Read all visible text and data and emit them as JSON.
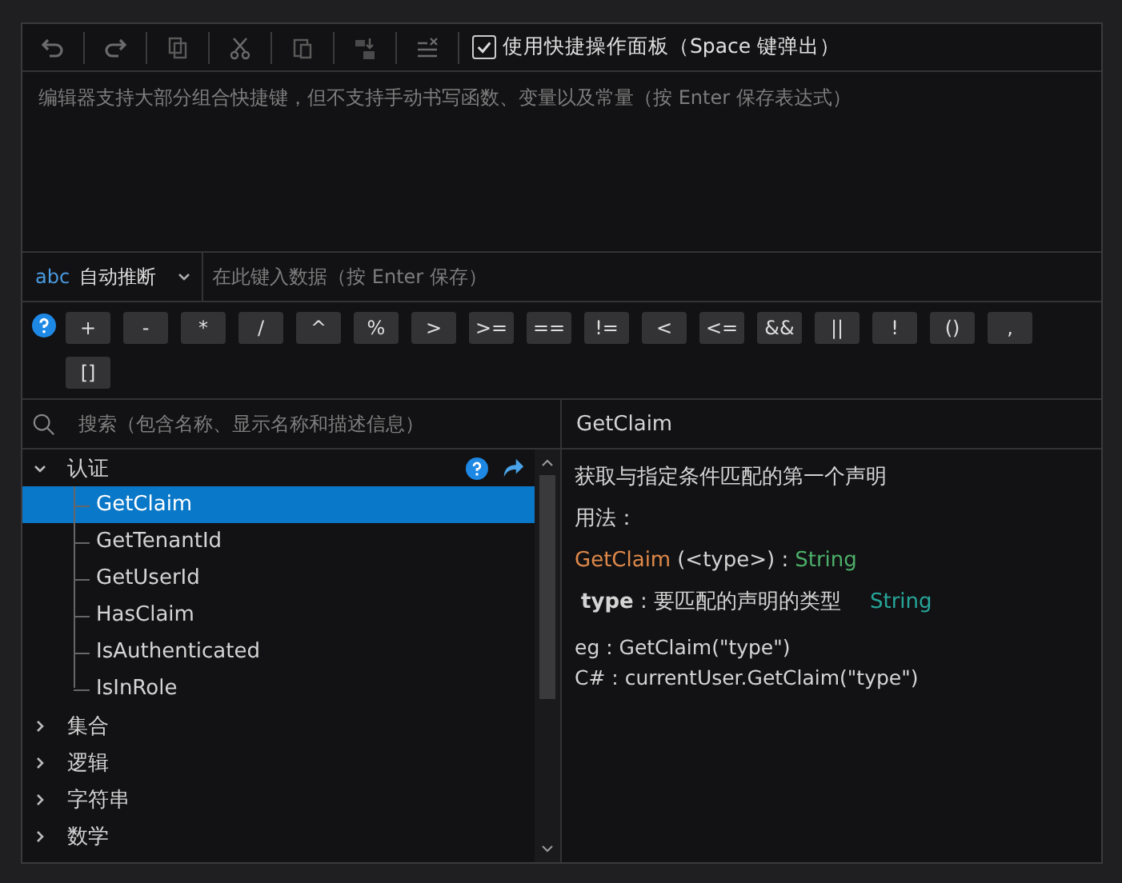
{
  "toolbar": {
    "shortcut_panel": {
      "label": "使用快捷操作面板（Space 键弹出）",
      "checked": true
    }
  },
  "editor": {
    "placeholder": "编辑器支持大部分组合快捷键，但不支持手动书写函数、变量以及常量（按 Enter 保存表达式）"
  },
  "type_row": {
    "type_badge": "abc",
    "type_value": "自动推断",
    "data_placeholder": "在此键入数据（按 Enter 保存）"
  },
  "operators": [
    "+",
    "-",
    "*",
    "/",
    "^",
    "%",
    ">",
    ">=",
    "==",
    "!=",
    "<",
    "<=",
    "&&",
    "||",
    "!",
    "()",
    ",",
    "[]"
  ],
  "tree": {
    "search_placeholder": "搜索（包含名称、显示名称和描述信息）",
    "groups": [
      {
        "label": "认证",
        "expanded": true,
        "children": [
          {
            "label": "GetClaim",
            "selected": true
          },
          {
            "label": "GetTenantId",
            "selected": false
          },
          {
            "label": "GetUserId",
            "selected": false
          },
          {
            "label": "HasClaim",
            "selected": false
          },
          {
            "label": "IsAuthenticated",
            "selected": false
          },
          {
            "label": "IsInRole",
            "selected": false
          }
        ]
      },
      {
        "label": "集合",
        "expanded": false
      },
      {
        "label": "逻辑",
        "expanded": false
      },
      {
        "label": "字符串",
        "expanded": false
      },
      {
        "label": "数学",
        "expanded": false
      }
    ]
  },
  "detail": {
    "title": "GetClaim",
    "description": "获取与指定条件匹配的第一个声明",
    "usage_label": "用法：",
    "signature": {
      "name": "GetClaim",
      "args": "(<type>) :",
      "returns": "String"
    },
    "parameter": {
      "text": "**type** : 要匹配的声明的类型",
      "type": "String"
    },
    "examples": [
      "eg : GetClaim(\"type\")",
      "C# : currentUser.GetClaim(\"type\")"
    ]
  }
}
